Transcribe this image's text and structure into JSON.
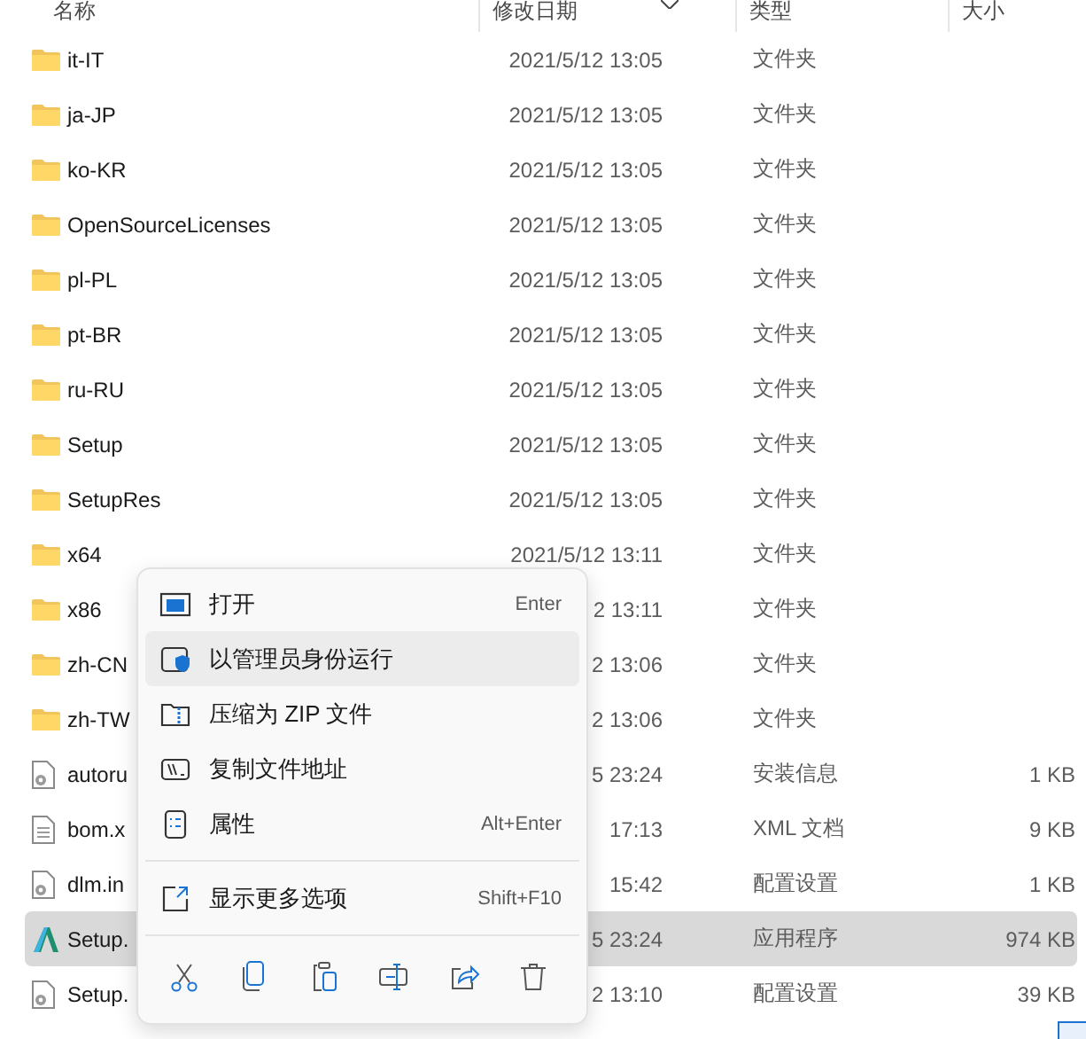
{
  "header": {
    "columns": [
      "名称",
      "修改日期",
      "类型",
      "大小"
    ]
  },
  "files": [
    {
      "kind": "folder",
      "name": "it-IT",
      "date": "2021/5/12 13:05",
      "type": "文件夹",
      "selected": false
    },
    {
      "kind": "folder",
      "name": "ja-JP",
      "date": "2021/5/12 13:05",
      "type": "文件夹",
      "selected": false
    },
    {
      "kind": "folder",
      "name": "ko-KR",
      "date": "2021/5/12 13:05",
      "type": "文件夹",
      "selected": false
    },
    {
      "kind": "folder",
      "name": "OpenSourceLicenses",
      "date": "2021/5/12 13:05",
      "type": "文件夹",
      "selected": false
    },
    {
      "kind": "folder",
      "name": "pl-PL",
      "date": "2021/5/12 13:05",
      "type": "文件夹",
      "selected": false
    },
    {
      "kind": "folder",
      "name": "pt-BR",
      "date": "2021/5/12 13:05",
      "type": "文件夹",
      "selected": false
    },
    {
      "kind": "folder",
      "name": "ru-RU",
      "date": "2021/5/12 13:05",
      "type": "文件夹",
      "selected": false
    },
    {
      "kind": "folder",
      "name": "Setup",
      "date": "2021/5/12 13:05",
      "type": "文件夹",
      "selected": false
    },
    {
      "kind": "folder",
      "name": "SetupRes",
      "date": "2021/5/12 13:05",
      "type": "文件夹",
      "selected": false
    },
    {
      "kind": "folder",
      "name": "x64",
      "date": "2021/5/12 13:11",
      "type": "文件夹",
      "selected": false
    },
    {
      "kind": "folder",
      "name": "x86",
      "date": "2 13:11",
      "type": "文件夹",
      "selected": false
    },
    {
      "kind": "folder",
      "name": "zh-CN",
      "date": "2 13:06",
      "type": "文件夹",
      "selected": false
    },
    {
      "kind": "folder",
      "name": "zh-TW",
      "date": "2 13:06",
      "type": "文件夹",
      "selected": false
    },
    {
      "kind": "settings",
      "name": "autoru",
      "date": "5 23:24",
      "type": "安装信息",
      "size": "1 KB",
      "selected": false
    },
    {
      "kind": "document",
      "name": "bom.x",
      "date": "17:13",
      "type": "XML 文档",
      "size": "9 KB",
      "selected": false
    },
    {
      "kind": "settings",
      "name": "dlm.in",
      "date": "15:42",
      "type": "配置设置",
      "size": "1 KB",
      "selected": false
    },
    {
      "kind": "app",
      "name": "Setup.",
      "date": "5 23:24",
      "type": "应用程序",
      "size": "974 KB",
      "selected": true
    },
    {
      "kind": "settings",
      "name": "Setup.",
      "date": "2 13:10",
      "type": "配置设置",
      "size": "39 KB",
      "selected": false
    }
  ],
  "context_menu": {
    "items": [
      {
        "kind": "open",
        "label": "打开",
        "shortcut": "Enter",
        "selected": false
      },
      {
        "kind": "admin",
        "label": "以管理员身份运行",
        "selected": true
      },
      {
        "kind": "zip",
        "label": "压缩为 ZIP 文件",
        "selected": false
      },
      {
        "kind": "path",
        "label": "复制文件地址",
        "selected": false
      },
      {
        "kind": "properties",
        "label": "属性",
        "shortcut": "Alt+Enter",
        "selected": false
      },
      {
        "kind": "more",
        "label": "显示更多选项",
        "shortcut": "Shift+F10",
        "selected": false
      }
    ]
  }
}
